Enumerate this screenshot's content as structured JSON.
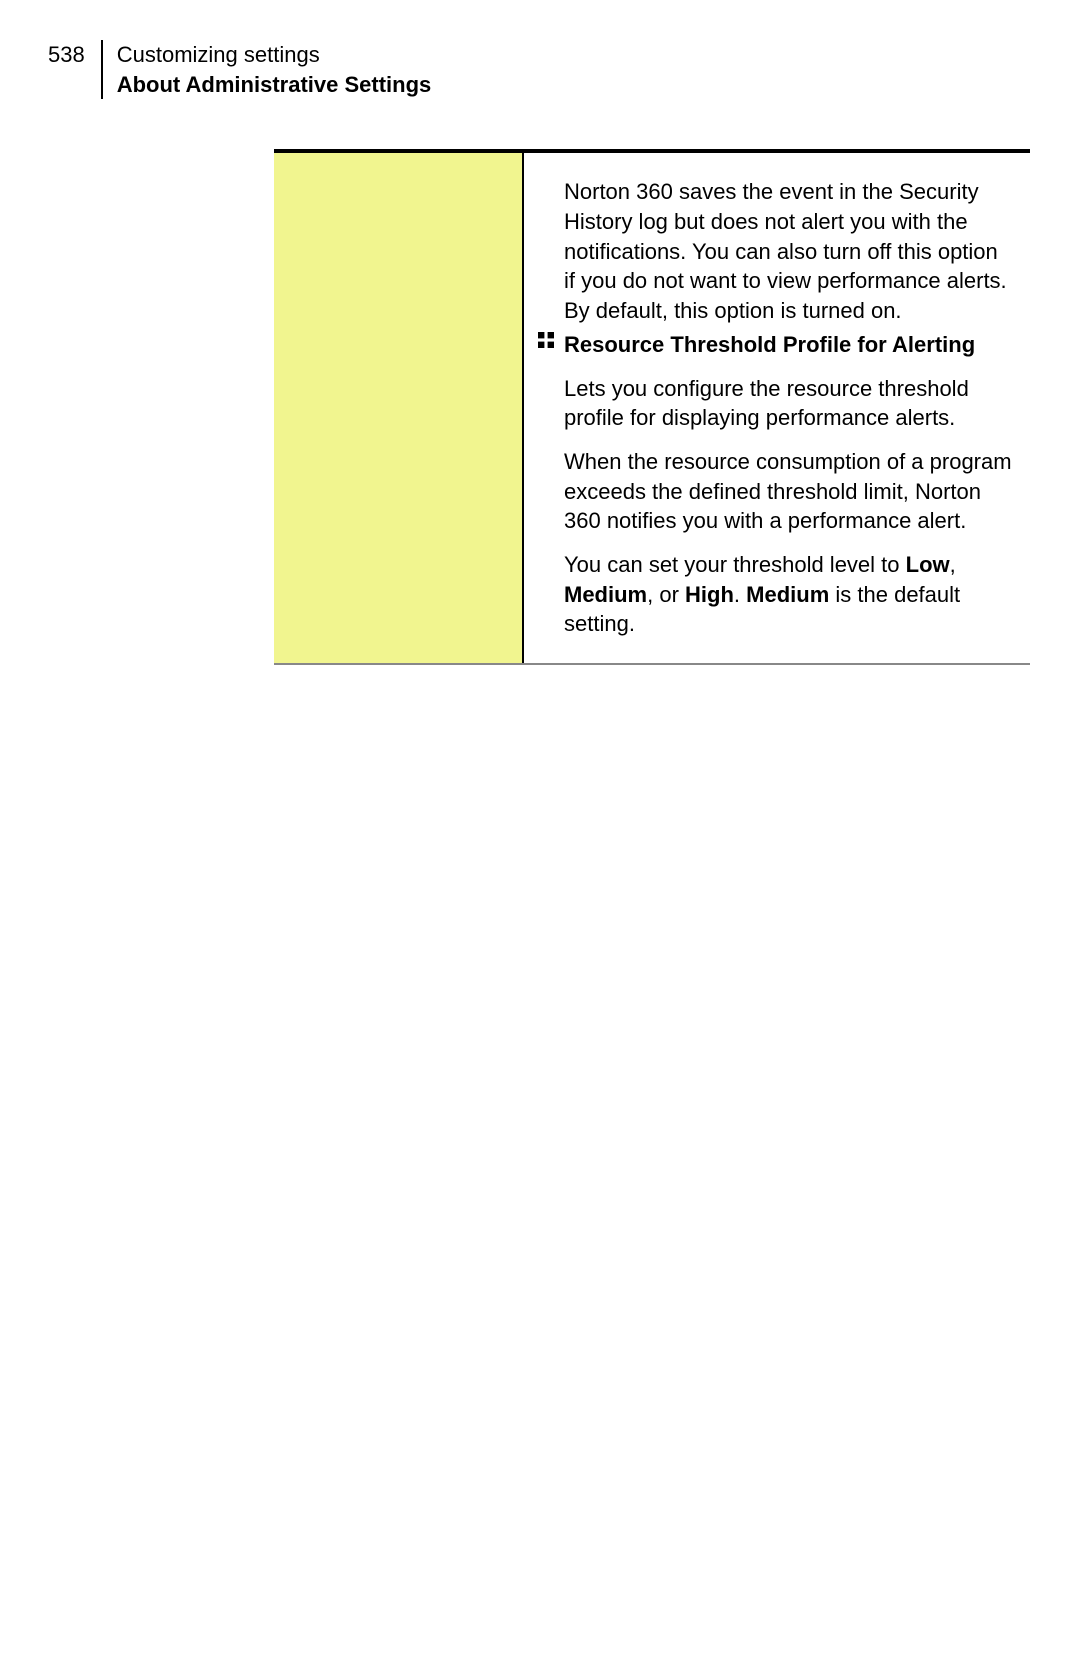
{
  "header": {
    "page_number": "538",
    "chapter": "Customizing settings",
    "section": "About Administrative Settings"
  },
  "content": {
    "leading_para": "Norton 360 saves the event in the Security History log but does not alert you with the notifications. You can also turn off this option if you do not want to view performance alerts. By default, this option is turned on.",
    "item_title": "Resource Threshold Profile for Alerting",
    "item_p1": "Lets you configure the resource threshold profile for displaying performance alerts.",
    "item_p2": "When the resource consumption of a program exceeds the defined threshold limit, Norton 360 notifies you with a performance alert.",
    "item_p3_pre": "You can set your threshold level to ",
    "low": "Low",
    "comma1": ", ",
    "medium1": "Medium",
    "comma2": ", or ",
    "high": "High",
    "period": ". ",
    "medium2": "Medium",
    "item_p3_post": " is the default setting."
  }
}
